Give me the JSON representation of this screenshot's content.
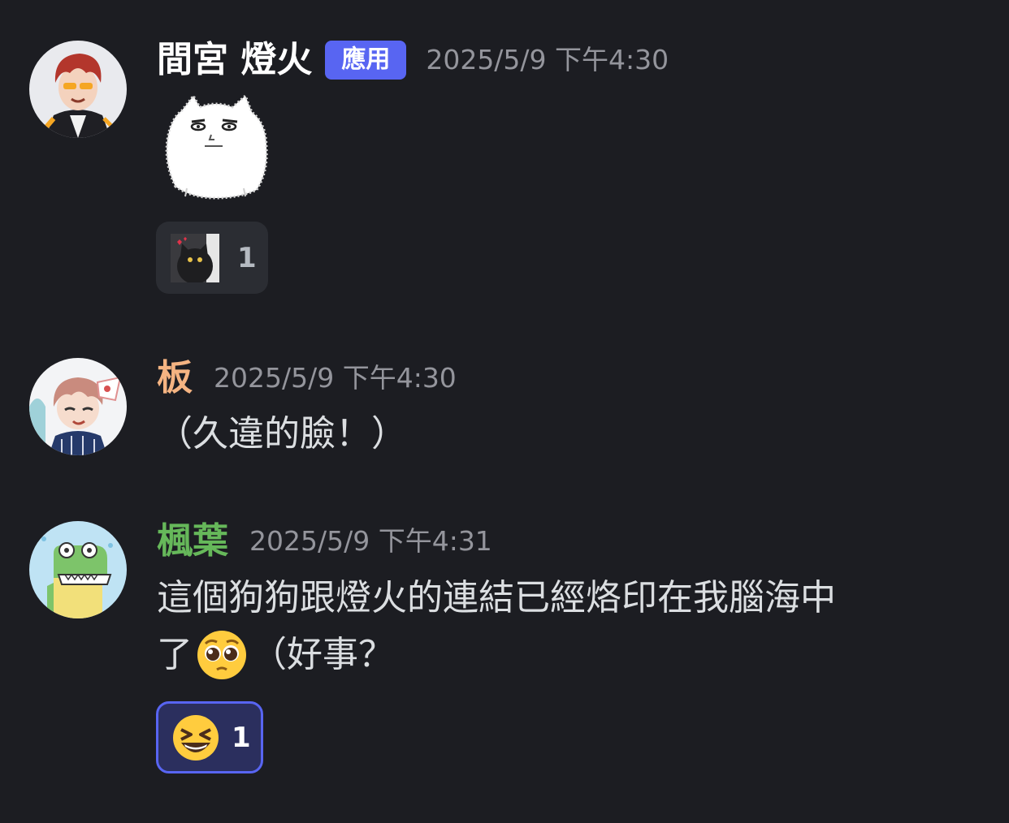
{
  "messages": [
    {
      "username": "間宮 燈火",
      "username_color": "#ffffff",
      "badge": "應用",
      "timestamp": "2025/5/9 下午4:30",
      "sticker": "white-fluffy-dog-sticker",
      "reaction": {
        "emoji": "black-cat-custom-emoji",
        "count": "1",
        "reacted_by_me": false
      }
    },
    {
      "username": "板",
      "username_color": "#f5b482",
      "timestamp": "2025/5/9 下午4:30",
      "text": "（久違的臉！）"
    },
    {
      "username": "楓葉",
      "username_color": "#66b85a",
      "timestamp": "2025/5/9 下午4:31",
      "text_line1": "這個狗狗跟燈火的連結已經烙印在我腦海中",
      "text_line2_before": "了",
      "text_line2_emoji": "pleading-face-emoji",
      "text_line2_after": "（好事？",
      "reaction": {
        "emoji": "grinning-squinting-face-emoji",
        "count": "1",
        "reacted_by_me": true
      }
    }
  ]
}
